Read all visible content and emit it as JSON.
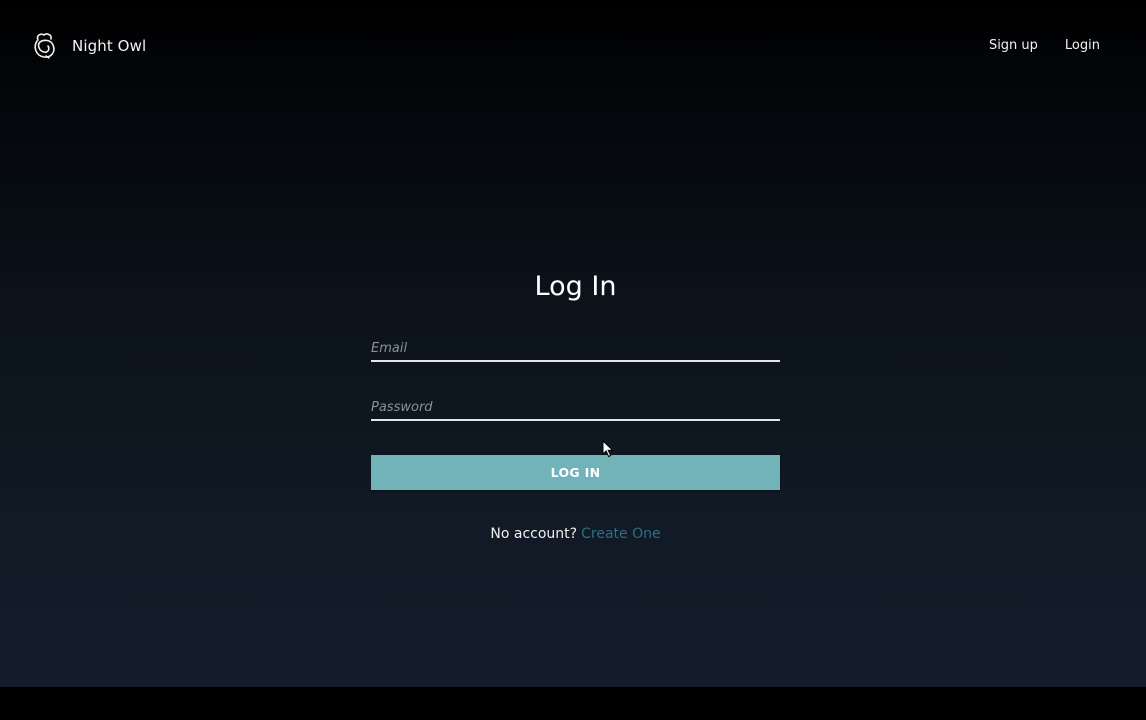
{
  "brand": {
    "name": "Night Owl",
    "logo_icon": "owl-logo-icon"
  },
  "nav": {
    "signup_label": "Sign up",
    "login_label": "Login"
  },
  "form": {
    "title": "Log In",
    "email_placeholder": "Email",
    "password_placeholder": "Password",
    "submit_label": "LOG IN",
    "no_account_text": "No account?",
    "create_link_label": "Create One"
  },
  "colors": {
    "button": "#72b3b9",
    "link": "#2a6f83",
    "text": "#f2f2f2"
  },
  "cursor_icon": "mouse-pointer-icon"
}
